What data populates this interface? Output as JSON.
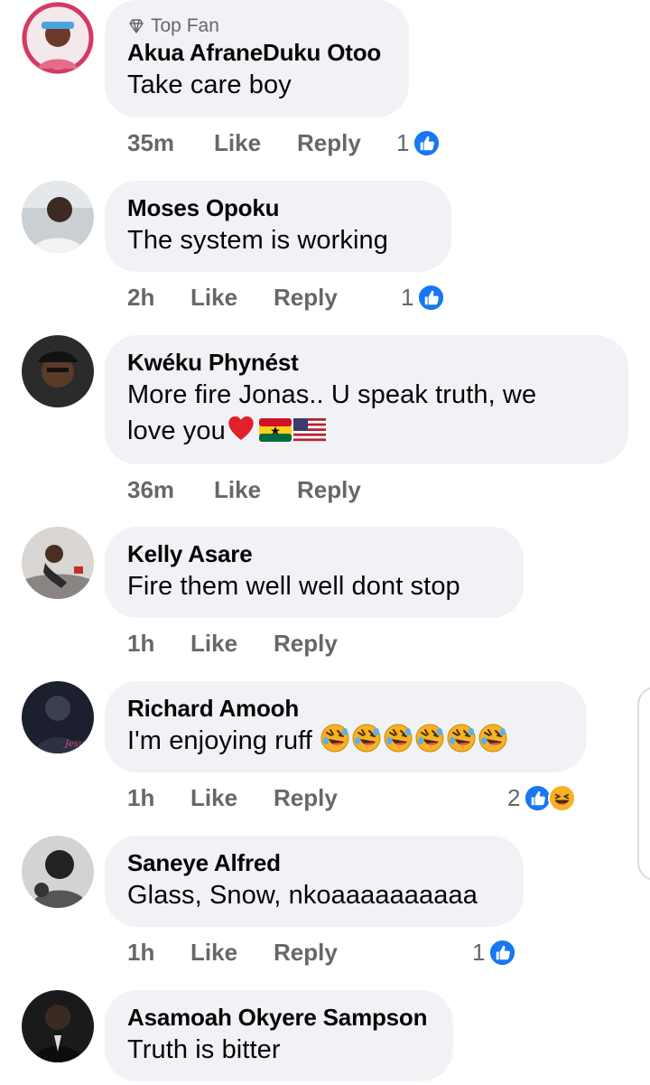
{
  "comments": [
    {
      "badge": "Top Fan",
      "name": "Akua AfraneDuku Otoo",
      "text": "Take care boy",
      "time": "35m",
      "like": "Like",
      "reply": "Reply",
      "reaction_count": "1",
      "reactions": [
        "like-icon"
      ]
    },
    {
      "name": "Moses Opoku",
      "text": "The system is working",
      "time": "2h",
      "like": "Like",
      "reply": "Reply",
      "reaction_count": "1",
      "reactions": [
        "like-icon"
      ]
    },
    {
      "name": "Kwéku Phynést",
      "text_line1": "More fire Jonas.. U speak truth, we",
      "text_line2": "love you",
      "emojis": [
        "red-heart-emoji",
        "ghana-flag-emoji",
        "us-flag-emoji"
      ],
      "time": "36m",
      "like": "Like",
      "reply": "Reply"
    },
    {
      "name": "Kelly Asare",
      "text": "Fire them well well dont stop",
      "time": "1h",
      "like": "Like",
      "reply": "Reply"
    },
    {
      "name": "Richard Amooh",
      "text": "I'm enjoying ruff",
      "emojis": [
        "rolling-laughing-emoji",
        "rolling-laughing-emoji",
        "rolling-laughing-emoji",
        "rolling-laughing-emoji",
        "rolling-laughing-emoji",
        "rolling-laughing-emoji"
      ],
      "time": "1h",
      "like": "Like",
      "reply": "Reply",
      "reaction_count": "2",
      "reactions": [
        "like-icon",
        "haha-icon"
      ]
    },
    {
      "name": "Saneye Alfred",
      "text": "Glass, Snow, nkoaaaaaaaaaa",
      "time": "1h",
      "like": "Like",
      "reply": "Reply",
      "reaction_count": "1",
      "reactions": [
        "like-icon"
      ]
    },
    {
      "name": "Asamoah Okyere Sampson",
      "text": "Truth is bitter"
    }
  ],
  "colors": {
    "bubble": "#f0f2f5",
    "action_text": "#65676b",
    "like_blue": "#1877f2",
    "haha_yellow": "#f7b125"
  }
}
